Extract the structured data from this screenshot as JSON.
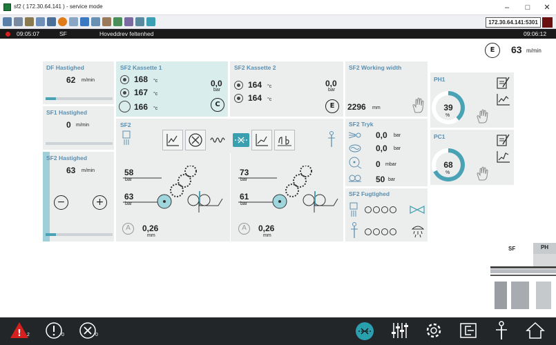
{
  "window": {
    "title": "sf2 ( 172.30.64.141 ) - service mode",
    "minimize": "–",
    "maximize": "□",
    "close": "✕"
  },
  "toolbar": {
    "ip_address": "172.30.64.141:5301"
  },
  "status": {
    "time_left": "09:05:07",
    "section": "SF",
    "message": "Hoveddrev feltenhed",
    "time_right": "09:06:12"
  },
  "speed": {
    "letter": "E",
    "value": "63",
    "unit": "m/min"
  },
  "df": {
    "title": "DF Hastighed",
    "value": "62",
    "unit": "m/min",
    "progress": 0.15
  },
  "sf1": {
    "title": "SF1 Hastighed",
    "value": "0",
    "unit": "m/min",
    "progress": 0
  },
  "sf2h": {
    "title": "SF2 Hastighed",
    "value": "63",
    "unit": "m/min",
    "minus": "−",
    "plus": "+",
    "progress": 0.15
  },
  "k1": {
    "title": "SF2 Kassette 1",
    "t1": "168",
    "t2": "167",
    "t3": "166",
    "tunit": "°c",
    "pressure": "0,0",
    "punit": "bar",
    "letter": "C"
  },
  "k2": {
    "title": "SF2 Kassette 2",
    "t1": "164",
    "t2": "164",
    "tunit": "°c",
    "pressure": "0,0",
    "punit": "bar",
    "letter": "E"
  },
  "ww": {
    "title": "SF2 Working width",
    "value": "2296",
    "unit": "mm"
  },
  "ph1": {
    "title": "PH1",
    "value": "39",
    "unit": "%",
    "level": 39
  },
  "pc1": {
    "title": "PC1",
    "value": "68",
    "unit": "%",
    "level": 68
  },
  "sf2": {
    "title": "SF2",
    "left": {
      "top": "58",
      "top_unit": "bar",
      "bot": "63",
      "bot_unit": "bar",
      "gap": "0,26",
      "gap_unit": "mm",
      "a": "A"
    },
    "right": {
      "top": "73",
      "top_unit": "bar",
      "bot": "61",
      "bot_unit": "bar",
      "gap": "0,26",
      "gap_unit": "mm",
      "a": "A"
    }
  },
  "tryk": {
    "title": "SF2 Tryk",
    "v1": "0,0",
    "u1": "bar",
    "v2": "0,0",
    "u2": "bar",
    "v3": "0",
    "u3": "mbar",
    "v4": "50",
    "u4": "bar"
  },
  "fug": {
    "title": "SF2 Fugtighed"
  },
  "minimap": {
    "sf": "SF",
    "ph": "PH"
  },
  "bottom": {
    "alarm_count": "2",
    "info_count": "0",
    "tool_count": "0"
  },
  "colors": {
    "accent": "#4aa3b5",
    "title_blue": "#5b8fb0",
    "panel_bg": "#eceded",
    "teal_bg": "#d9eded",
    "alarm_red": "#d61f1f",
    "status_bar": "#1a1a1a"
  }
}
